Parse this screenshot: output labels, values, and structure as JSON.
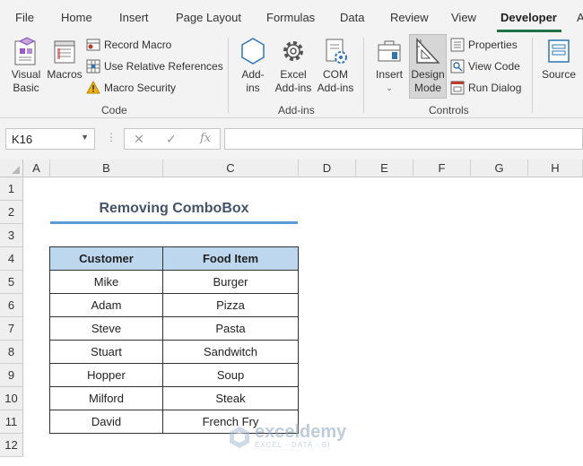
{
  "menu": {
    "tabs": [
      "File",
      "Home",
      "Insert",
      "Page Layout",
      "Formulas",
      "Data",
      "Review",
      "View",
      "Developer",
      "A"
    ],
    "active": "Developer"
  },
  "ribbon": {
    "code": {
      "label": "Code",
      "visual_basic": [
        "Visual",
        "Basic"
      ],
      "macros": "Macros",
      "record_macro": "Record Macro",
      "use_relative_references": "Use Relative References",
      "macro_security": "Macro Security"
    },
    "addins": {
      "label": "Add-ins",
      "addins_btn": [
        "Add-",
        "ins"
      ],
      "excel_addins": [
        "Excel",
        "Add-ins"
      ],
      "com_addins": [
        "COM",
        "Add-ins"
      ]
    },
    "controls": {
      "label": "Controls",
      "insert": "Insert",
      "design_mode": [
        "Design",
        "Mode"
      ],
      "properties": "Properties",
      "view_code": "View Code",
      "run_dialog": "Run Dialog"
    },
    "xml": {
      "source": "Source"
    }
  },
  "formula_bar": {
    "name_box": "K16",
    "fx": "fx",
    "content": ""
  },
  "sheet": {
    "columns": [
      "A",
      "B",
      "C",
      "D",
      "E",
      "F",
      "G",
      "H"
    ],
    "rows": [
      "1",
      "2",
      "3",
      "4",
      "5",
      "6",
      "7",
      "8",
      "9",
      "10",
      "11",
      "12"
    ],
    "title": "Removing ComboBox",
    "table": {
      "headers": [
        "Customer",
        "Food Item"
      ],
      "rows": [
        [
          "Mike",
          "Burger"
        ],
        [
          "Adam",
          "Pizza"
        ],
        [
          "Steve",
          "Pasta"
        ],
        [
          "Stuart",
          "Sandwitch"
        ],
        [
          "Hopper",
          "Soup"
        ],
        [
          "Milford",
          "Steak"
        ],
        [
          "David",
          "French Fry"
        ]
      ]
    }
  },
  "watermark": {
    "name": "exceldemy",
    "tagline": "EXCEL · DATA · BI"
  },
  "colors": {
    "accent": "#217346",
    "header_fill": "#bdd7ee",
    "title_color": "#44546a",
    "title_underline": "#5b9bd5"
  }
}
